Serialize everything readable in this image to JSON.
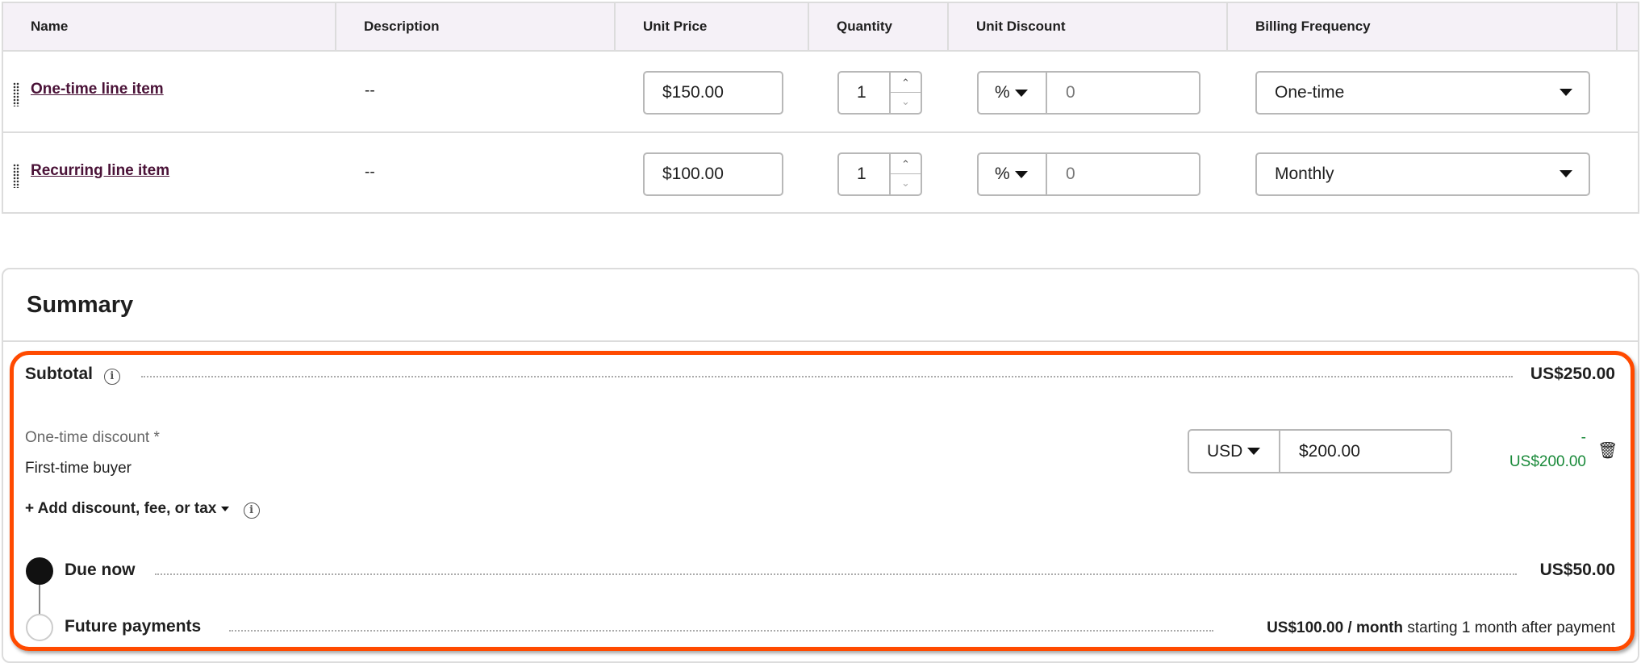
{
  "table": {
    "headers": [
      "Name",
      "Description",
      "Unit Price",
      "Quantity",
      "Unit Discount",
      "Billing Frequency"
    ],
    "rows": [
      {
        "name": "One-time line item",
        "description": "--",
        "unit_price": "$150.00",
        "quantity": "1",
        "discount_type": "%",
        "discount_value": "0",
        "billing_frequency": "One-time"
      },
      {
        "name": "Recurring line item",
        "description": "--",
        "unit_price": "$100.00",
        "quantity": "1",
        "discount_type": "%",
        "discount_value": "0",
        "billing_frequency": "Monthly"
      }
    ]
  },
  "summary": {
    "title": "Summary",
    "subtotal_label": "Subtotal",
    "subtotal_value": "US$250.00",
    "discount": {
      "label": "One-time discount *",
      "name": "First-time buyer",
      "currency": "USD",
      "amount": "$200.00",
      "minus": "-",
      "applied": "US$200.00"
    },
    "add_label": "+ Add discount, fee, or tax",
    "due_now_label": "Due now",
    "due_now_value": "US$50.00",
    "future_label": "Future payments",
    "future_value": "US$100.00 / month",
    "future_suffix": "starting 1 month after payment"
  },
  "colors": {
    "highlight": "#ff4a00",
    "link": "#4a1237",
    "discount_green": "#1a8a3a",
    "header_bg": "#f5f1f7"
  }
}
